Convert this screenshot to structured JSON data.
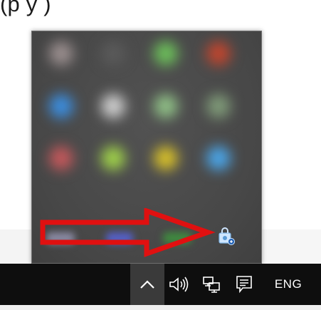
{
  "caption": {
    "text": "(p  y      )"
  },
  "overflow_panel": {
    "icons": [
      {
        "name": "tray-icon-1",
        "color": "#9b8f8f"
      },
      {
        "name": "tray-icon-2",
        "color": "#5a5a5a"
      },
      {
        "name": "tray-icon-3",
        "color": "#6cbf5a"
      },
      {
        "name": "tray-icon-4",
        "color": "#c0452e"
      },
      {
        "name": "tray-icon-5",
        "color": "#3b8ee0"
      },
      {
        "name": "tray-icon-6",
        "color": "#cfcfcf"
      },
      {
        "name": "tray-icon-7",
        "color": "#8fbf86"
      },
      {
        "name": "tray-icon-8",
        "color": "#7f9a78"
      },
      {
        "name": "tray-icon-9",
        "color": "#c4585b"
      },
      {
        "name": "tray-icon-10",
        "color": "#9fd14a"
      },
      {
        "name": "tray-icon-11",
        "color": "#d6bf2a"
      },
      {
        "name": "tray-icon-12",
        "color": "#4aa5e8"
      }
    ],
    "badge_icon": "store-bag-icon"
  },
  "annotation": {
    "arrow_color": "#e01010"
  },
  "taskbar": {
    "chevron_icon": "chevron-up-icon",
    "volume_icon": "speaker-icon",
    "network_icon": "network-icon",
    "notification_icon": "action-center-icon",
    "language_label": "ENG"
  }
}
